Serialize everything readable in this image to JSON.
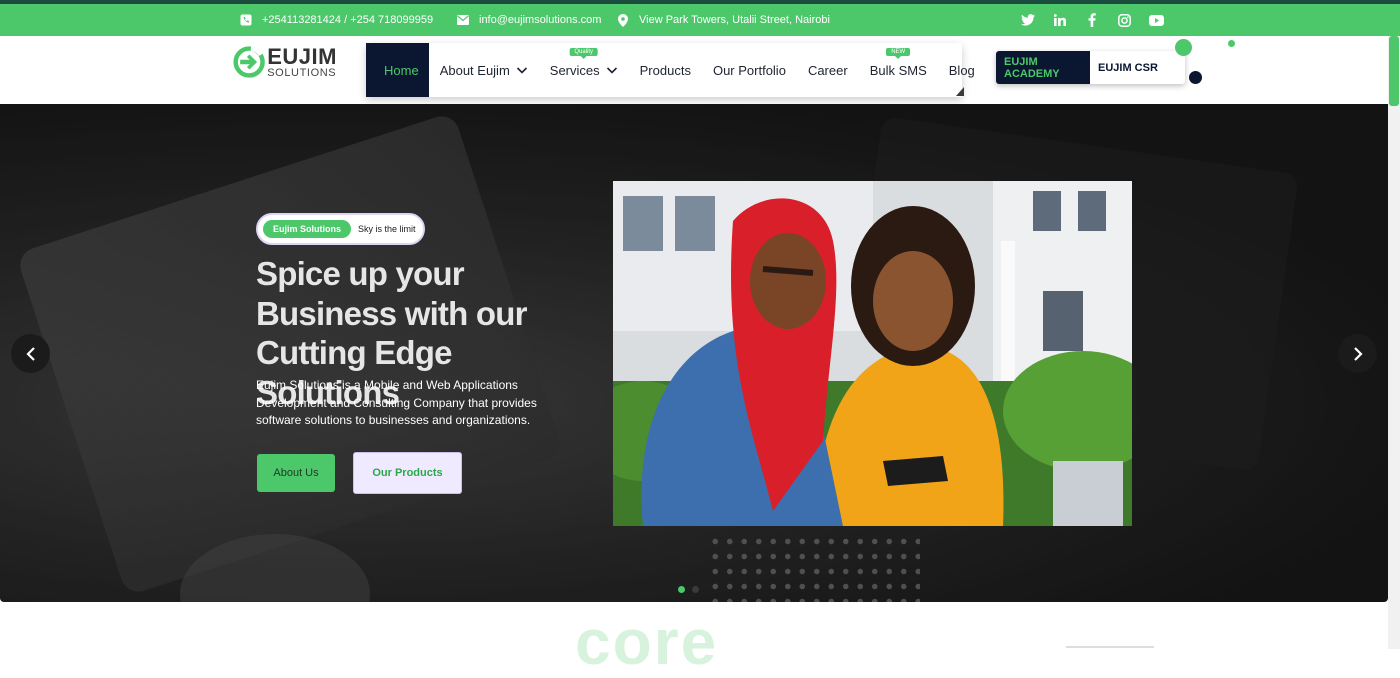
{
  "topbar": {
    "phone": "+254113281424 / +254 718099959",
    "email": "info@eujimsolutions.com",
    "address": "View Park Towers, Utalii Street, Nairobi",
    "socials": [
      "twitter-icon",
      "linkedin-icon",
      "facebook-icon",
      "instagram-icon",
      "youtube-icon"
    ]
  },
  "logo": {
    "title": "EUJIM",
    "subtitle": "SOLUTIONS"
  },
  "nav": {
    "home": "Home",
    "about": "About Eujim",
    "services": "Services",
    "services_badge": "Quality",
    "products": "Products",
    "portfolio": "Our Portfolio",
    "career": "Career",
    "bulk_sms": "Bulk SMS",
    "bulk_sms_badge": "NEW",
    "blog": "Blog"
  },
  "cta": {
    "academy": "EUJIM ACADEMY",
    "csr": "EUJIM CSR"
  },
  "hero": {
    "pill_tag": "Eujim Solutions",
    "pill_text": "Sky is the limit",
    "headline": "Spice up your Business with our Cutting Edge Solutions",
    "lead": "Eujim Solutions is a Mobile and Web Applications Development and Consulting Company that provides software solutions to businesses and organizations.",
    "btn_about": "About Us",
    "btn_products": "Our Products",
    "slides_total": 2,
    "slide_active": 1
  },
  "below": {
    "partial_heading": "core"
  },
  "colors": {
    "green": "#4cc86a",
    "navy": "#0b1631",
    "dark_top": "#1b4d3e"
  }
}
